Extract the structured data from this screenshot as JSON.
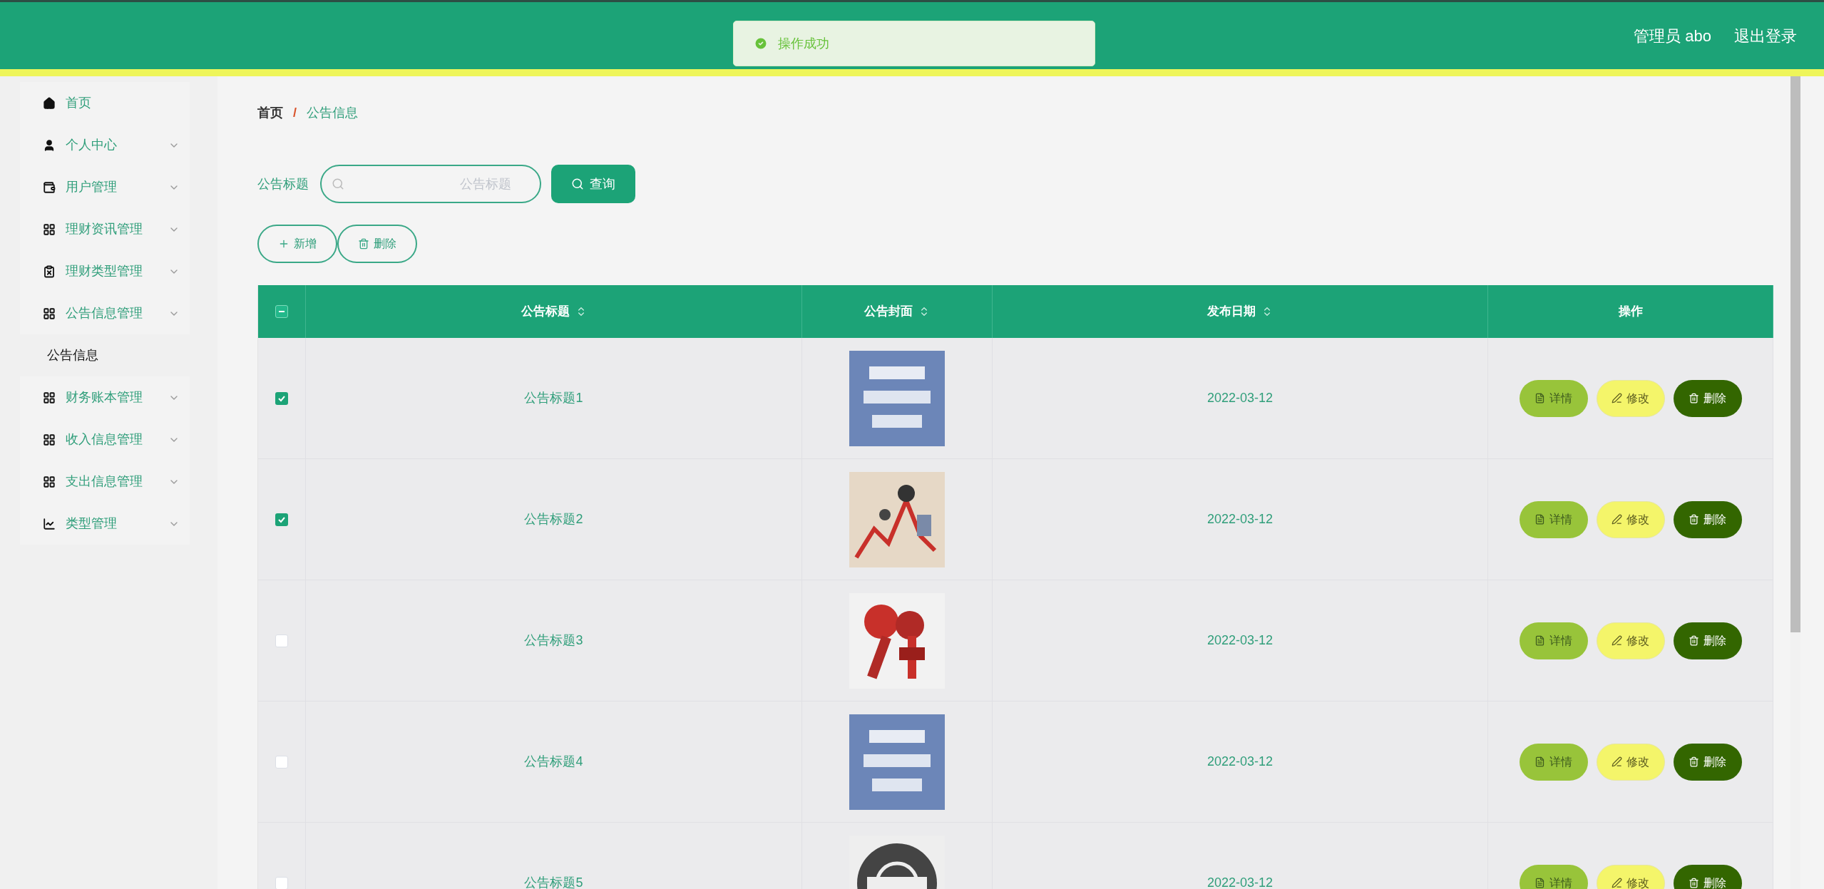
{
  "header": {
    "user": "管理员 abo",
    "logout": "退出登录"
  },
  "toast": {
    "message": "操作成功"
  },
  "sidebar": {
    "items": [
      {
        "label": "首页",
        "kind": "link"
      },
      {
        "label": "个人中心",
        "kind": "menu"
      },
      {
        "label": "用户管理",
        "kind": "menu"
      },
      {
        "label": "理财资讯管理",
        "kind": "menu"
      },
      {
        "label": "理财类型管理",
        "kind": "menu"
      },
      {
        "label": "公告信息管理",
        "kind": "menu",
        "children": [
          {
            "label": "公告信息",
            "selected": true
          }
        ]
      },
      {
        "label": "财务账本管理",
        "kind": "menu"
      },
      {
        "label": "收入信息管理",
        "kind": "menu"
      },
      {
        "label": "支出信息管理",
        "kind": "menu"
      },
      {
        "label": "类型管理",
        "kind": "menu"
      }
    ]
  },
  "breadcrumb": {
    "separator": "/",
    "items": [
      {
        "label": "首页"
      },
      {
        "label": "公告信息"
      }
    ]
  },
  "search": {
    "label": "公告标题",
    "placeholder": "公告标题",
    "button": "查询"
  },
  "toolbar": [
    {
      "label": "新增",
      "kind": "add"
    },
    {
      "label": "删除",
      "kind": "delete"
    }
  ],
  "table": {
    "header_checkbox": {
      "indeterminate": true
    },
    "columns": [
      {
        "label": "公告标题",
        "sortable": true
      },
      {
        "label": "公告封面",
        "sortable": true
      },
      {
        "label": "发布日期",
        "sortable": true
      },
      {
        "label": "操作",
        "sortable": false
      }
    ],
    "rows": [
      {
        "checked": true,
        "title": "公告标题1",
        "cover": {
          "kind": "picture"
        },
        "date": "2022-03-12",
        "actions": [
          {
            "label": "详情",
            "kind": "detail"
          },
          {
            "label": "修改",
            "kind": "edit"
          },
          {
            "label": "删除",
            "kind": "delete"
          }
        ]
      },
      {
        "checked": true,
        "title": "公告标题2",
        "cover": {
          "kind": "picture"
        },
        "date": "2022-03-12",
        "actions": [
          {
            "label": "详情",
            "kind": "detail"
          },
          {
            "label": "修改",
            "kind": "edit"
          },
          {
            "label": "删除",
            "kind": "delete"
          }
        ]
      },
      {
        "checked": false,
        "title": "公告标题3",
        "cover": {
          "kind": "picture"
        },
        "date": "2022-03-12",
        "actions": [
          {
            "label": "详情",
            "kind": "detail"
          },
          {
            "label": "修改",
            "kind": "edit"
          },
          {
            "label": "删除",
            "kind": "delete"
          }
        ]
      },
      {
        "checked": false,
        "title": "公告标题4",
        "cover": {
          "kind": "picture"
        },
        "date": "2022-03-12",
        "actions": [
          {
            "label": "详情",
            "kind": "detail"
          },
          {
            "label": "修改",
            "kind": "edit"
          },
          {
            "label": "删除",
            "kind": "delete"
          }
        ]
      },
      {
        "checked": false,
        "title": "公告标题5",
        "cover": {
          "kind": "picture"
        },
        "date": "2022-03-12",
        "actions": [
          {
            "label": "详情",
            "kind": "detail"
          },
          {
            "label": "修改",
            "kind": "edit"
          },
          {
            "label": "删除",
            "kind": "delete"
          }
        ]
      }
    ]
  }
}
